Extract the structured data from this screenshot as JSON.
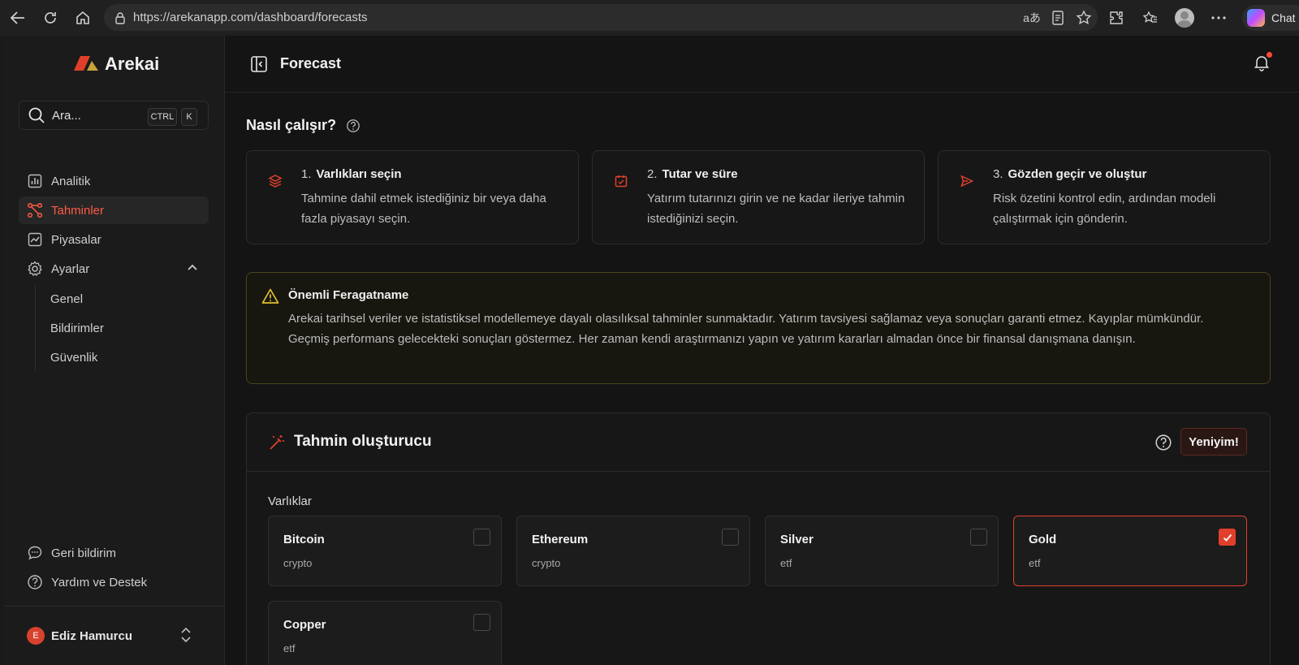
{
  "browser": {
    "url": "https://arekanapp.com/dashboard/forecasts",
    "copilot_label": "Chat"
  },
  "sidebar": {
    "brand": "Arekai",
    "search": {
      "placeholder": "Ara...",
      "kbd_ctrl": "CTRL",
      "kbd_k": "K"
    },
    "items": [
      {
        "label": "Analitik",
        "icon": "bar-chart-icon"
      },
      {
        "label": "Tahminler",
        "icon": "network-icon",
        "active": true
      },
      {
        "label": "Piyasalar",
        "icon": "line-chart-icon"
      },
      {
        "label": "Ayarlar",
        "icon": "gear-icon",
        "expanded": true
      }
    ],
    "settings_sub": [
      "Genel",
      "Bildirimler",
      "Güvenlik"
    ],
    "bottom": [
      {
        "label": "Geri bildirim",
        "icon": "chat-bubble-icon"
      },
      {
        "label": "Yardım ve Destek",
        "icon": "help-circle-icon"
      }
    ],
    "user": {
      "initial": "E",
      "name": "Ediz Hamurcu"
    }
  },
  "topbar": {
    "title": "Forecast"
  },
  "howto": {
    "title": "Nasıl çalışır?",
    "steps": [
      {
        "num": "1.",
        "title": "Varlıkları seçin",
        "desc": "Tahmine dahil etmek istediğiniz bir veya daha fazla piyasayı seçin."
      },
      {
        "num": "2.",
        "title": "Tutar ve süre",
        "desc": "Yatırım tutarınızı girin ve ne kadar ileriye tahmin istediğinizi seçin."
      },
      {
        "num": "3.",
        "title": "Gözden geçir ve oluştur",
        "desc": "Risk özetini kontrol edin, ardından modeli çalıştırmak için gönderin."
      }
    ]
  },
  "disclaimer": {
    "title": "Önemli Feragatname",
    "text": "Arekai tarihsel veriler ve istatistiksel modellemeye dayalı olasılıksal tahminler sunmaktadır. Yatırım tavsiyesi sağlamaz veya sonuçları garanti etmez. Kayıplar mümkündür. Geçmiş performans gelecekteki sonuçları göstermez. Her zaman kendi araştırmanızı yapın ve yatırım kararları almadan önce bir finansal danışmana danışın."
  },
  "builder": {
    "title": "Tahmin oluşturucu",
    "new_button": "Yeniyim!",
    "assets_label": "Varlıklar",
    "assets": [
      {
        "name": "Bitcoin",
        "type": "crypto",
        "selected": false
      },
      {
        "name": "Ethereum",
        "type": "crypto",
        "selected": false
      },
      {
        "name": "Silver",
        "type": "etf",
        "selected": false
      },
      {
        "name": "Gold",
        "type": "etf",
        "selected": true
      },
      {
        "name": "Copper",
        "type": "etf",
        "selected": false
      }
    ]
  },
  "colors": {
    "accent": "#e0402b",
    "warning": "#e3c12b",
    "background": "#141414"
  }
}
